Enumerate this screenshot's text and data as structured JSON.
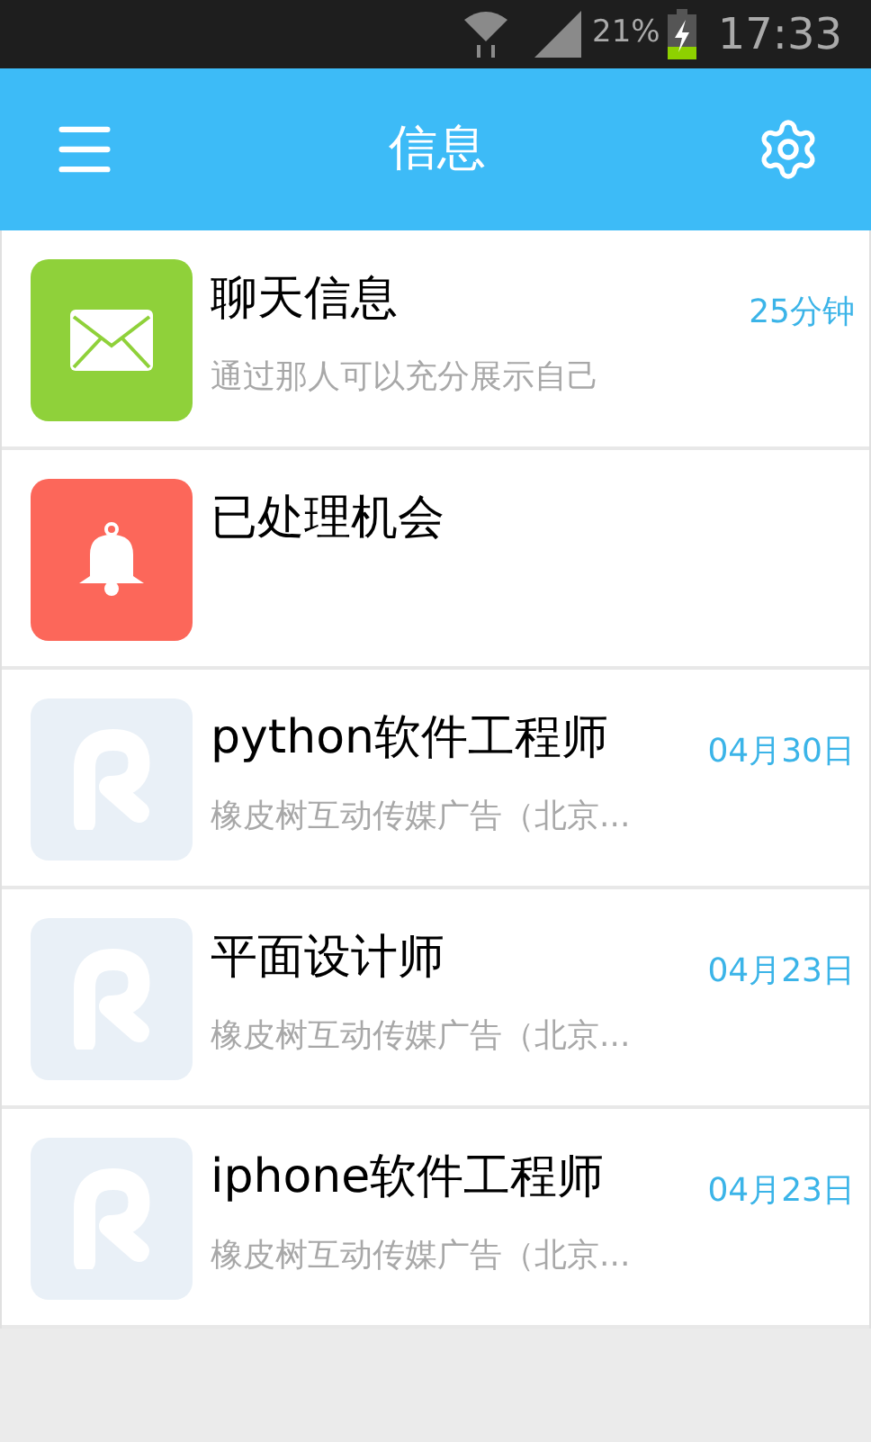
{
  "status_bar": {
    "battery_percent": "21%",
    "time": "17:33"
  },
  "header": {
    "title": "信息"
  },
  "messages": [
    {
      "kind": "mail",
      "title": "聊天信息",
      "subtitle": "通过那人可以充分展示自己",
      "time": "25分钟"
    },
    {
      "kind": "bell",
      "title": "已处理机会"
    },
    {
      "kind": "logo",
      "title": "python软件工程师",
      "subtitle": "橡皮树互动传媒广告（北京...",
      "time": "04月30日"
    },
    {
      "kind": "logo",
      "title": "平面设计师",
      "subtitle": "橡皮树互动传媒广告（北京...",
      "time": "04月23日"
    },
    {
      "kind": "logo",
      "title": "iphone软件工程师",
      "subtitle": "橡皮树互动传媒广告（北京...",
      "time": "04月23日"
    }
  ]
}
